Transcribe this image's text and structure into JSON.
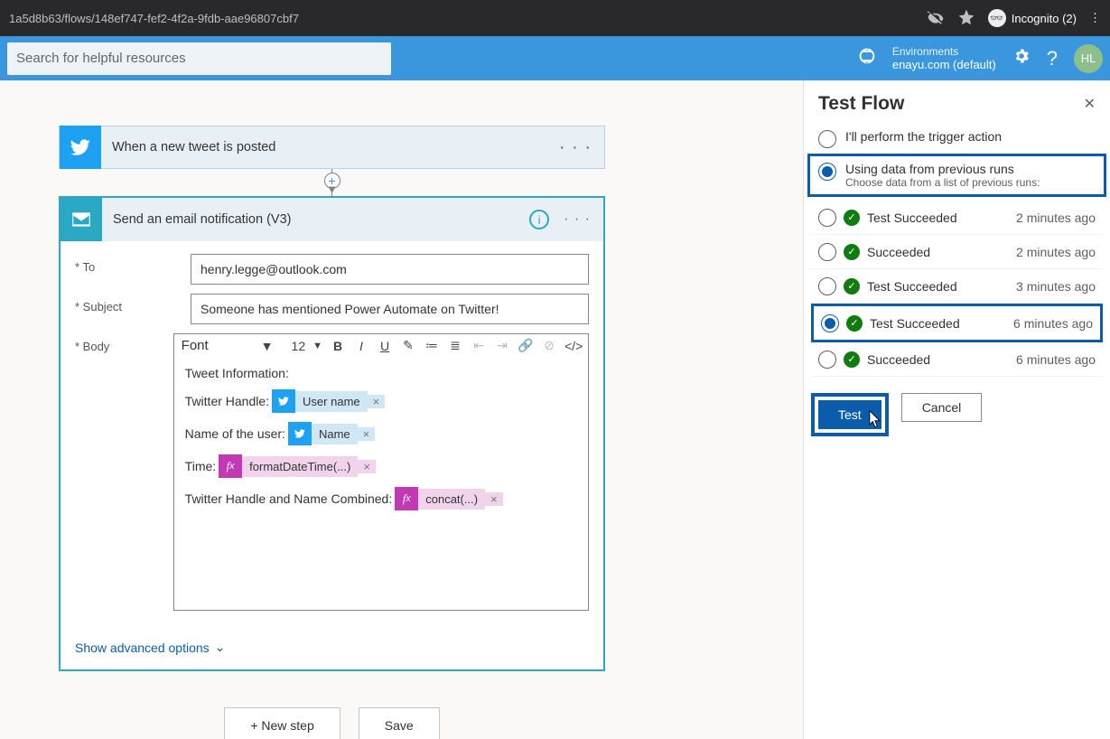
{
  "browser": {
    "url": "1a5d8b63/flows/148ef747-fef2-4f2a-9fdb-aae96807cbf7",
    "incognito": "Incognito (2)"
  },
  "suite": {
    "search_placeholder": "Search for helpful resources",
    "env_label": "Environments",
    "env_name": "enayu.com (default)",
    "avatar": "HL"
  },
  "test_panel": {
    "title": "Test Flow",
    "opt_manual": "I'll perform the trigger action",
    "opt_previous": "Using data from previous runs",
    "opt_previous_sub": "Choose data from a list of previous runs:",
    "runs": [
      {
        "label": "Test Succeeded",
        "time": "2 minutes ago",
        "selected": false,
        "hl": false
      },
      {
        "label": "Succeeded",
        "time": "2 minutes ago",
        "selected": false,
        "hl": false
      },
      {
        "label": "Test Succeeded",
        "time": "3 minutes ago",
        "selected": false,
        "hl": false
      },
      {
        "label": "Test Succeeded",
        "time": "6 minutes ago",
        "selected": true,
        "hl": true
      },
      {
        "label": "Succeeded",
        "time": "6 minutes ago",
        "selected": false,
        "hl": false
      }
    ],
    "test_btn": "Test",
    "cancel_btn": "Cancel"
  },
  "trigger": {
    "title": "When a new tweet is posted"
  },
  "action": {
    "title": "Send an email notification (V3)",
    "to_label": "To",
    "subject_label": "Subject",
    "body_label": "Body",
    "to_value": "henry.legge@outlook.com",
    "subject_value": "Someone has mentioned Power Automate on Twitter!",
    "font_label": "Font",
    "font_size": "12",
    "body_intro": "Tweet Information:",
    "line_handle": "Twitter Handle:",
    "token_user": "User name",
    "line_name": "Name of the user:",
    "token_name": "Name",
    "line_time": "Time:",
    "token_fdt": "formatDateTime(...)",
    "line_combo": "Twitter Handle and Name Combined:",
    "token_concat": "concat(...)",
    "advanced": "Show advanced options"
  },
  "bottom": {
    "new_step": "+ New step",
    "save": "Save"
  }
}
